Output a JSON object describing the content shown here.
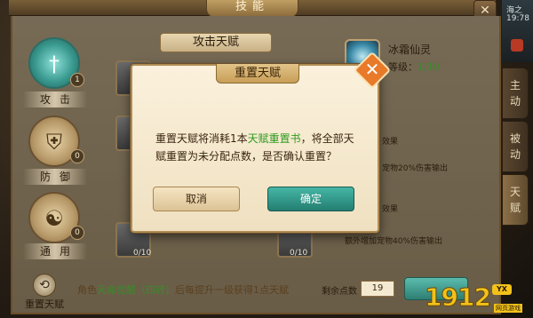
{
  "header": {
    "title": "技能",
    "close_glyph": "✕"
  },
  "hud": {
    "server_text": "海之",
    "time": "19:78"
  },
  "tabs": [
    {
      "label": "攻击",
      "badge": "1",
      "icon": "sword-icon"
    },
    {
      "label": "防御",
      "badge": "0",
      "icon": "shield-icon"
    },
    {
      "label": "通用",
      "badge": "0",
      "icon": "yin-yang-icon"
    }
  ],
  "tree": {
    "header": "攻击天赋",
    "slot_counts": [
      "0/10",
      "0/10"
    ]
  },
  "detail": {
    "name": "冰霜仙灵",
    "level_label": "等级：",
    "level_value": "1/10",
    "fragments": [
      "效果",
      "宠物20%伤害输出",
      "效果",
      "额外增加宠物40%伤害输出"
    ]
  },
  "side_tabs": [
    {
      "line1": "主",
      "line2": "动"
    },
    {
      "line1": "被",
      "line2": "动"
    },
    {
      "line1": "天",
      "line2": "赋"
    }
  ],
  "bottom": {
    "reset_label": "重置天赋",
    "info_pre": "角色",
    "info_highlight": "天命觉醒（四转）",
    "info_post": "后每提升一级获得1点天赋",
    "remain_label": "剩余点数",
    "remain_value": "19"
  },
  "watermark": {
    "number": "1912",
    "badge": "YX",
    "sub": "网页游戏"
  },
  "dialog": {
    "title": "重置天赋",
    "close_glyph": "✕",
    "msg_pre": "重置天赋将消耗1本",
    "msg_highlight": "天赋重置书",
    "msg_post": "，将全部天赋重置为未分配点数，是否确认重置？",
    "cancel_label": "取消",
    "ok_label": "确定"
  },
  "colors": {
    "highlight_green": "#2e9a1e",
    "accent_teal": "#2e8a7e",
    "close_orange": "#e87a2a"
  }
}
